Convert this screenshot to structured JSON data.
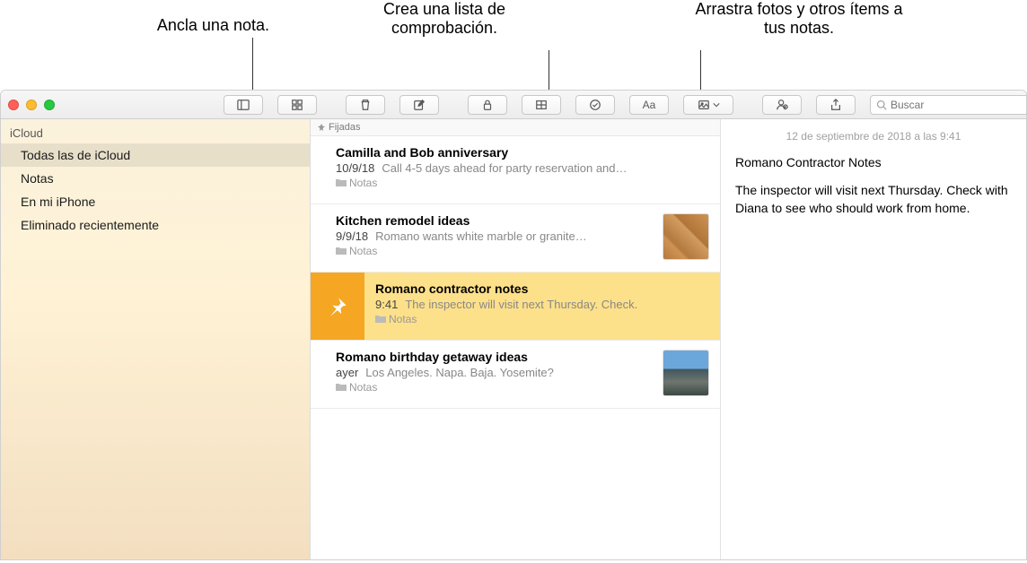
{
  "callouts": {
    "pin": "Ancla una nota.",
    "checklist": "Crea una lista de comprobación.",
    "drag": "Arrastra fotos y otros ítems a tus notas."
  },
  "toolbar": {
    "search_placeholder": "Buscar"
  },
  "sidebar": {
    "section": "iCloud",
    "items": [
      {
        "label": "Todas las de iCloud",
        "selected": true
      },
      {
        "label": "Notas",
        "selected": false
      },
      {
        "label": "En mi iPhone",
        "selected": false
      },
      {
        "label": "Eliminado recientemente",
        "selected": false
      }
    ]
  },
  "list": {
    "pinned_label": "Fijadas",
    "notes": [
      {
        "title": "Camilla and Bob anniversary",
        "date": "10/9/18",
        "preview": "Call 4-5 days ahead for party reservation and…",
        "folder": "Notas",
        "thumb": null,
        "selected": false
      },
      {
        "title": "Kitchen remodel ideas",
        "date": "9/9/18",
        "preview": "Romano wants white marble or granite…",
        "folder": "Notas",
        "thumb": "wood",
        "selected": false
      },
      {
        "title": "Romano contractor notes",
        "date": "9:41",
        "preview": "The inspector will visit next Thursday. Check.",
        "folder": "Notas",
        "thumb": null,
        "selected": true
      },
      {
        "title": "Romano birthday getaway ideas",
        "date": "ayer",
        "preview": "Los Angeles. Napa. Baja. Yosemite?",
        "folder": "Notas",
        "thumb": "rocks",
        "selected": false
      }
    ]
  },
  "reader": {
    "date": "12 de septiembre de 2018 a las 9:41",
    "title": "Romano Contractor Notes",
    "body": "The inspector will visit next Thursday. Check with Diana to see who should work from home."
  }
}
